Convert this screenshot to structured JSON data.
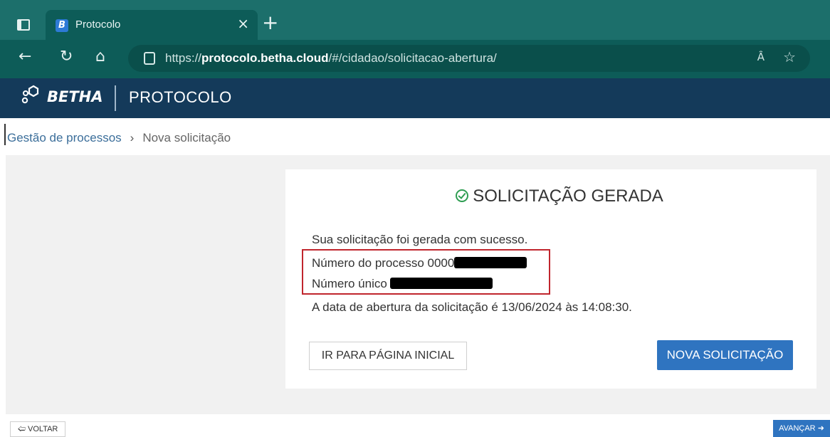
{
  "browser": {
    "tab_title": "Protocolo",
    "tab_favicon_letter": "B",
    "close_glyph": "×",
    "new_tab_glyph": "+",
    "url_prefix": "https://",
    "url_domain": "protocolo.betha.cloud",
    "url_path": "/#/cidadao/solicitacao-abertura/",
    "read_aloud_glyph": "Ȃ",
    "icons": [
      "window-icon",
      "back-icon",
      "refresh-icon",
      "home-icon",
      "lock-icon",
      "read-aloud-icon",
      "favorite-star-icon"
    ]
  },
  "app": {
    "brand": "BETHA",
    "product": "PROTOCOLO",
    "accent_color": "#143a5a"
  },
  "breadcrumb": {
    "link": "Gestão de processos",
    "separator": "›",
    "current": "Nova solicitação"
  },
  "card": {
    "title": "SOLICITAÇÃO GERADA",
    "success_message": "Sua solicitação foi gerada com sucesso.",
    "process_number_label": "Número do processo 0000",
    "unique_number_label": "Número único",
    "opening_date_text": "A data de abertura da solicitação é 13/06/2024 às 14:08:30.",
    "home_button": "IR PARA PÁGINA INICIAL",
    "new_request_button": "NOVA SOLICITAÇÃO",
    "success_color": "#2e9d52",
    "highlight_color": "#c0262d",
    "primary_color": "#2f74c0"
  },
  "footer": {
    "back_label": "VOLTAR",
    "next_label": "AVANÇAR"
  }
}
